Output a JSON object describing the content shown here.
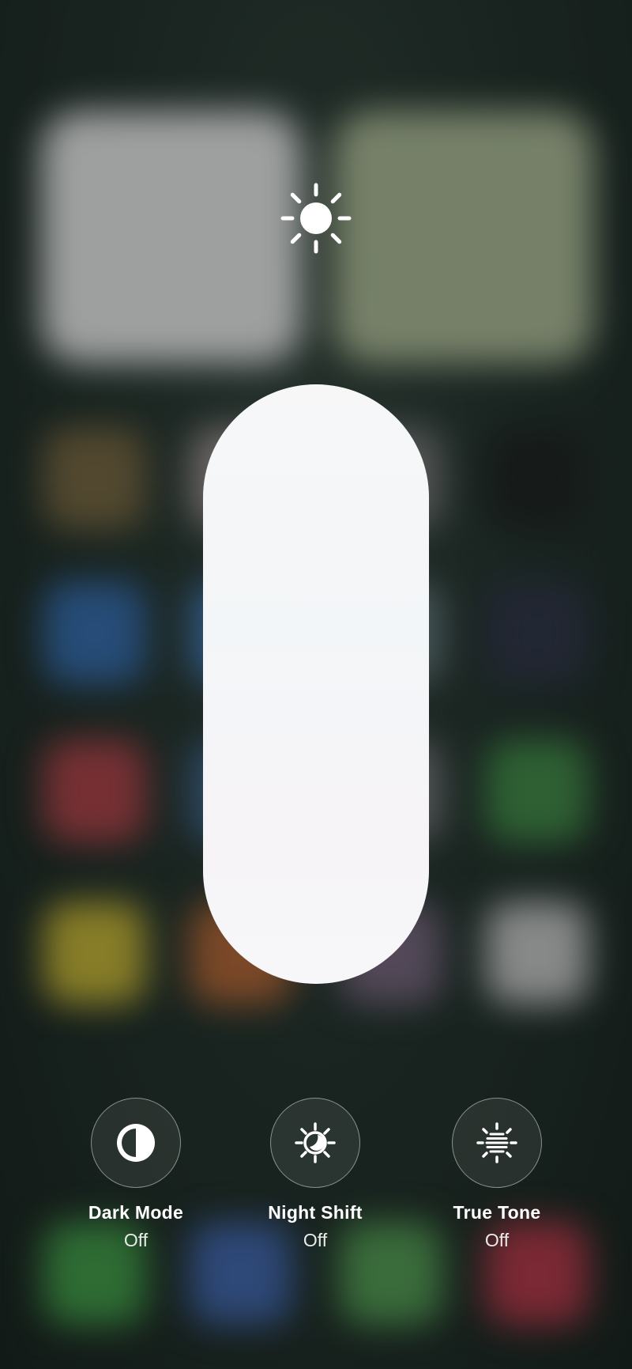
{
  "brightness": {
    "level_percent": 100,
    "icon": "sun-icon"
  },
  "toggles": [
    {
      "label": "Dark Mode",
      "state": "Off",
      "icon": "dark-mode-icon"
    },
    {
      "label": "Night Shift",
      "state": "Off",
      "icon": "night-shift-icon"
    },
    {
      "label": "True Tone",
      "state": "Off",
      "icon": "true-tone-icon"
    }
  ],
  "colors": {
    "slider_fill": "#f6f6f8",
    "toggle_border": "#9aa3a0",
    "text": "#ffffff"
  }
}
